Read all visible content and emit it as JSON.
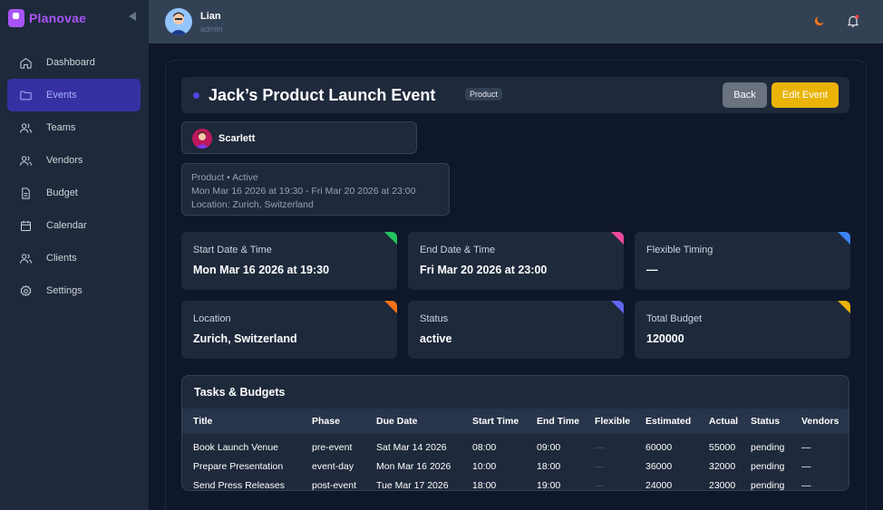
{
  "app": {
    "name": "Planovae"
  },
  "sidebar": {
    "items": [
      {
        "label": "Dashboard",
        "icon": "home-icon",
        "active": false
      },
      {
        "label": "Events",
        "icon": "folder-icon",
        "active": true
      },
      {
        "label": "Teams",
        "icon": "users-icon",
        "active": false
      },
      {
        "label": "Vendors",
        "icon": "users-icon",
        "active": false
      },
      {
        "label": "Budget",
        "icon": "document-icon",
        "active": false
      },
      {
        "label": "Calendar",
        "icon": "calendar-icon",
        "active": false
      },
      {
        "label": "Clients",
        "icon": "users-icon",
        "active": false
      },
      {
        "label": "Settings",
        "icon": "gear-icon",
        "active": false
      }
    ]
  },
  "header": {
    "user_name": "Lian",
    "user_role": "admin"
  },
  "event": {
    "title": "Jack’s Product Launch Event",
    "category_badge": "Product",
    "back_label": "Back",
    "edit_label": "Edit Event",
    "owner": "Scarlett",
    "summary_line1": "Product • Active",
    "summary_line2": "Mon Mar 16 2026 at 19:30 - Fri Mar 20 2026 at 23:00",
    "summary_line3": "Location: Zurich, Switzerland"
  },
  "cards": [
    {
      "label": "Start Date & Time",
      "value": "Mon Mar 16 2026 at 19:30",
      "accent": "#22c55e"
    },
    {
      "label": "End Date & Time",
      "value": "Fri Mar 20 2026 at 23:00",
      "accent": "#ec4899"
    },
    {
      "label": "Flexible Timing",
      "value": "—",
      "accent": "#3b82f6"
    },
    {
      "label": "Location",
      "value": "Zurich, Switzerland",
      "accent": "#f97316"
    },
    {
      "label": "Status",
      "value": "active",
      "accent": "#6366f1"
    },
    {
      "label": "Total Budget",
      "value": "120000",
      "accent": "#eab308"
    }
  ],
  "tasks": {
    "title": "Tasks & Budgets",
    "columns": [
      "Title",
      "Phase",
      "Due Date",
      "Start Time",
      "End Time",
      "Flexible",
      "Estimated",
      "Actual",
      "Status",
      "Vendors"
    ],
    "rows": [
      [
        "Book Launch Venue",
        "pre-event",
        "Sat Mar 14 2026",
        "08:00",
        "09:00",
        "—",
        "60000",
        "55000",
        "pending",
        "—"
      ],
      [
        "Prepare Presentation",
        "event-day",
        "Mon Mar 16 2026",
        "10:00",
        "18:00",
        "—",
        "36000",
        "32000",
        "pending",
        "—"
      ],
      [
        "Send Press Releases",
        "post-event",
        "Tue Mar 17 2026",
        "18:00",
        "19:00",
        "—",
        "24000",
        "23000",
        "pending",
        "—"
      ]
    ]
  }
}
